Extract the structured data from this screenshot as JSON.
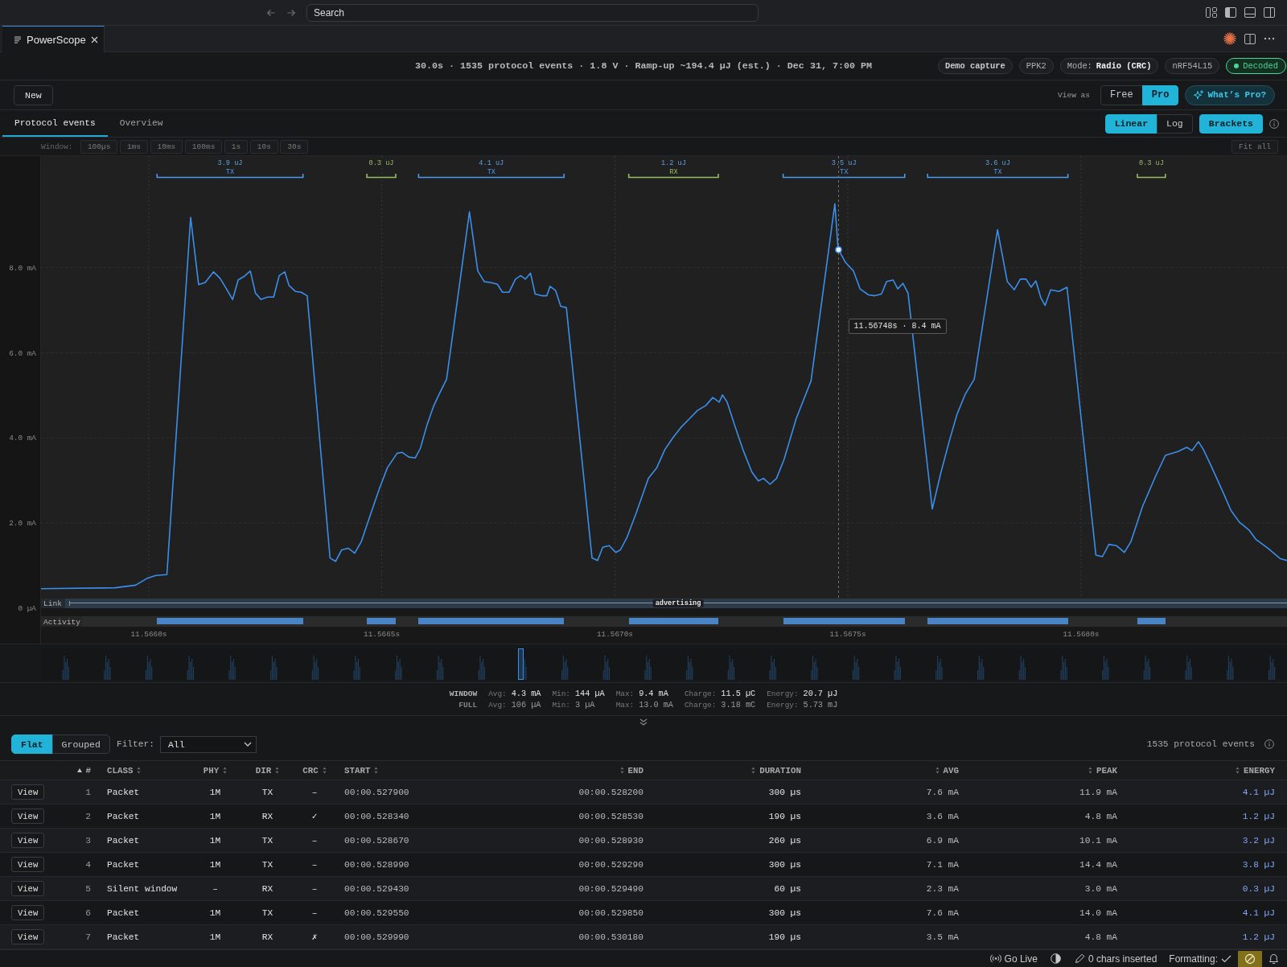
{
  "title_bar": {
    "search": {
      "placeholder": "Search"
    }
  },
  "editor_tabs": [
    {
      "label": "PowerScope",
      "selected": true
    }
  ],
  "header": {
    "summary": "30.0s · 1535 protocol events · 1.8 V · Ramp-up ~194.4 µJ (est.) · Dec 31, 7:00 PM",
    "badges": [
      {
        "kind": "strong",
        "text": "Demo capture"
      },
      {
        "kind": "plain",
        "text": "PPK2"
      },
      {
        "kind": "plain",
        "text": "Mode: **Radio (CRC)**"
      },
      {
        "kind": "plain",
        "text": "nRF54L15"
      },
      {
        "kind": "status",
        "text": "Decoded",
        "color": "#4cd49a"
      }
    ]
  },
  "toolbar": {
    "new_button": "New",
    "view_as_label": "View as",
    "view_as": [
      {
        "label": "Free",
        "selected": false
      },
      {
        "label": "Pro",
        "selected": true
      }
    ],
    "whats_pro_button": "What’s Pro?"
  },
  "view_tabs": [
    {
      "label": "Protocol events",
      "selected": true
    },
    {
      "label": "Overview",
      "selected": false
    }
  ],
  "scale": [
    {
      "label": "Linear",
      "selected": true
    },
    {
      "label": "Log",
      "selected": false
    }
  ],
  "brackets_toggle": {
    "label": "Brackets",
    "on": true
  },
  "window_bar": {
    "label": "Window:",
    "options": [
      {
        "label": "100µs",
        "selected": false
      },
      {
        "label": "1ms",
        "selected": false
      },
      {
        "label": "10ms",
        "selected": false
      },
      {
        "label": "100ms",
        "selected": false
      },
      {
        "label": "1s",
        "selected": false
      },
      {
        "label": "10s",
        "selected": false
      },
      {
        "label": "30s",
        "selected": false
      }
    ],
    "fit_all_button": "Fit all"
  },
  "chart": {
    "brackets": [
      {
        "energy": "3.9 uJ",
        "label": "TX",
        "color": "#4a9aee"
      },
      {
        "energy": "0.3 uJ",
        "color": "#97bd62"
      },
      {
        "energy": "4.1 uJ",
        "label": "TX",
        "color": "#4a9aee"
      },
      {
        "energy": "1.2 uJ",
        "label": "RX",
        "color": "#97bd62"
      },
      {
        "energy": "3.5 uJ",
        "label": "TX",
        "color": "#4a9aee"
      },
      {
        "energy": "3.6 uJ",
        "label": "TX",
        "color": "#4a9aee"
      },
      {
        "energy": "0.3 uJ",
        "color": "#97bd62"
      }
    ],
    "link": {
      "label": "Link",
      "state": "advertising"
    },
    "activity_label": "Activity",
    "chart_data": [
      {
        "type": "line",
        "xlim": [
          11.565769,
          11.568442
        ],
        "ylim": [
          0,
          10.62
        ],
        "xticks": [
          {
            "value": 11.566,
            "label": "11.5660s"
          },
          {
            "value": 11.5665,
            "label": "11.5665s"
          },
          {
            "value": 11.567,
            "label": "11.5670s"
          },
          {
            "value": 11.5675,
            "label": "11.5675s"
          },
          {
            "value": 11.568,
            "label": "11.5680s"
          }
        ],
        "yticks": [
          {
            "value": 0,
            "label": "0 µA"
          },
          {
            "value": 2,
            "label": "2.0 mA"
          },
          {
            "value": 4,
            "label": "4.0 mA"
          },
          {
            "value": 6,
            "label": "6.0 mA"
          },
          {
            "value": 8,
            "label": "8.0 mA"
          }
        ],
        "grid": true,
        "color": "#3b8fea",
        "x": [
          11.565769,
          11.565928,
          11.565972,
          11.565998,
          11.566016,
          11.566039,
          11.56609,
          11.566107,
          11.566121,
          11.566139,
          11.566153,
          11.566167,
          11.56618,
          11.566192,
          11.566204,
          11.566218,
          11.566229,
          11.566241,
          11.566255,
          11.566268,
          11.56628,
          11.566292,
          11.566301,
          11.566315,
          11.566327,
          11.56634,
          11.566389,
          11.566401,
          11.566414,
          11.566428,
          11.566442,
          11.566456,
          11.566474,
          11.566495,
          11.566512,
          11.566533,
          11.566544,
          11.566558,
          11.566572,
          11.566583,
          11.566597,
          11.566611,
          11.566625,
          11.566639,
          11.566688,
          11.566706,
          11.56672,
          11.566734,
          11.566748,
          11.566759,
          11.566773,
          11.566787,
          11.566798,
          11.566808,
          11.566819,
          11.566829,
          11.566843,
          11.566854,
          11.566861,
          11.566873,
          11.566884,
          11.566896,
          11.566951,
          11.566963,
          11.566974,
          11.566988,
          11.567002,
          11.567012,
          11.567026,
          11.567046,
          11.567072,
          11.56709,
          11.567107,
          11.567125,
          11.567143,
          11.56716,
          11.567178,
          11.567195,
          11.56721,
          11.567224,
          11.567231,
          11.567241,
          11.567257,
          11.567275,
          11.567294,
          11.567308,
          11.567319,
          11.567333,
          11.567347,
          11.567363,
          11.567389,
          11.567421,
          11.567472,
          11.567479,
          11.567495,
          11.567512,
          11.567526,
          11.567544,
          11.567558,
          11.567572,
          11.567583,
          11.567597,
          11.567607,
          11.567618,
          11.567629,
          11.567681,
          11.567699,
          11.567717,
          11.567734,
          11.567752,
          11.567771,
          11.567821,
          11.567842,
          11.567857,
          11.56787,
          11.567882,
          11.567893,
          11.567903,
          11.567914,
          11.567923,
          11.567935,
          11.567953,
          11.56797,
          11.568032,
          11.568046,
          11.56806,
          11.568076,
          11.568093,
          11.568107,
          11.568132,
          11.56816,
          11.568181,
          11.568208,
          11.568227,
          11.568238,
          11.568252,
          11.568262,
          11.568278,
          11.568305,
          11.568322,
          11.56834,
          11.568361,
          11.568375,
          11.568401,
          11.568428,
          11.568442
        ],
        "values": [
          0.46,
          0.48,
          0.54,
          0.71,
          0.77,
          0.79,
          9.18,
          7.6,
          7.65,
          7.9,
          7.75,
          7.5,
          7.25,
          7.71,
          7.79,
          7.92,
          7.4,
          7.25,
          7.31,
          7.31,
          7.81,
          7.9,
          7.58,
          7.44,
          7.42,
          7.34,
          1.18,
          1.1,
          1.37,
          1.41,
          1.29,
          1.56,
          2.14,
          2.81,
          3.3,
          3.64,
          3.66,
          3.55,
          3.53,
          3.76,
          4.3,
          4.74,
          5.07,
          5.38,
          9.31,
          7.92,
          7.67,
          7.65,
          7.61,
          7.42,
          7.42,
          7.73,
          7.81,
          7.73,
          7.87,
          7.38,
          7.34,
          7.34,
          7.56,
          7.46,
          7.09,
          7.06,
          1.18,
          1.12,
          1.43,
          1.47,
          1.31,
          1.37,
          1.66,
          2.24,
          3.05,
          3.3,
          3.72,
          4.01,
          4.26,
          4.45,
          4.65,
          4.76,
          4.95,
          4.84,
          5.01,
          4.84,
          4.3,
          3.72,
          3.2,
          2.99,
          3.05,
          2.91,
          3.05,
          3.49,
          4.45,
          5.34,
          9.5,
          8.44,
          8.12,
          7.92,
          7.5,
          7.36,
          7.34,
          7.38,
          7.67,
          7.71,
          7.5,
          7.63,
          7.4,
          2.33,
          3.16,
          3.91,
          4.55,
          5.03,
          5.38,
          8.89,
          7.67,
          7.48,
          7.73,
          7.73,
          7.54,
          7.69,
          7.29,
          7.11,
          7.48,
          7.44,
          7.54,
          1.25,
          1.21,
          1.5,
          1.47,
          1.31,
          1.56,
          2.39,
          3.1,
          3.59,
          3.68,
          3.78,
          3.7,
          3.91,
          3.74,
          3.37,
          2.72,
          2.29,
          2.02,
          1.83,
          1.62,
          1.41,
          1.16,
          1.12
        ],
        "ref_lines": [
          {
            "axis": "x",
            "value": 11.56748,
            "label": "11.56748s · 8.4 mA",
            "color": "#707070",
            "line_style": "dashed"
          }
        ]
      }
    ]
  },
  "stats": [
    {
      "label": "WINDOW",
      "highlighted": true,
      "items": [
        {
          "name": "Avg:",
          "value": "4.3 mA"
        },
        {
          "name": "Min:",
          "value": "144 µA"
        },
        {
          "name": "Max:",
          "value": "9.4 mA"
        },
        {
          "name": "Charge:",
          "value": "11.5 µC"
        },
        {
          "name": "Energy:",
          "value": "20.7 µJ"
        }
      ]
    },
    {
      "label": "FULL",
      "highlighted": false,
      "items": [
        {
          "name": "Avg:",
          "value": "106 µA"
        },
        {
          "name": "Min:",
          "value": "3 µA"
        },
        {
          "name": "Max:",
          "value": "13.0 mA"
        },
        {
          "name": "Charge:",
          "value": "3.18 mC"
        },
        {
          "name": "Energy:",
          "value": "5.73 mJ"
        }
      ]
    }
  ],
  "events": {
    "modes": [
      {
        "label": "Flat",
        "selected": true
      },
      {
        "label": "Grouped",
        "selected": false
      }
    ],
    "filter": {
      "label": "Filter:",
      "value": "All"
    },
    "count": "1535 protocol events",
    "columns": [
      {
        "label": "#",
        "sorted": true
      },
      {
        "label": "CLASS",
        "sorted": false
      },
      {
        "label": "PHY",
        "sorted": false
      },
      {
        "label": "DIR",
        "sorted": false
      },
      {
        "label": "CRC",
        "sorted": false
      },
      {
        "label": "START",
        "sorted": false
      },
      {
        "label": "END",
        "sorted": false
      },
      {
        "label": "DURATION",
        "sorted": false
      },
      {
        "label": "AVG",
        "sorted": false
      },
      {
        "label": "PEAK",
        "sorted": false
      },
      {
        "label": "ENERGY",
        "sorted": false
      }
    ],
    "rows": [
      {
        "action": "View",
        "cells": [
          "1",
          "Packet",
          "1M",
          "TX",
          "–",
          "00:00.527900",
          "00:00.528200",
          "300 µs",
          "7.6 mA",
          "11.9 mA",
          "4.1 µJ"
        ]
      },
      {
        "action": "View",
        "cells": [
          "2",
          "Packet",
          "1M",
          "RX",
          "✓",
          "00:00.528340",
          "00:00.528530",
          "190 µs",
          "3.6 mA",
          "4.8 mA",
          "1.2 µJ"
        ]
      },
      {
        "action": "View",
        "cells": [
          "3",
          "Packet",
          "1M",
          "TX",
          "–",
          "00:00.528670",
          "00:00.528930",
          "260 µs",
          "6.9 mA",
          "10.1 mA",
          "3.2 µJ"
        ]
      },
      {
        "action": "View",
        "cells": [
          "4",
          "Packet",
          "1M",
          "TX",
          "–",
          "00:00.528990",
          "00:00.529290",
          "300 µs",
          "7.1 mA",
          "14.4 mA",
          "3.8 µJ"
        ]
      },
      {
        "action": "View",
        "cells": [
          "5",
          "Silent window",
          "–",
          "RX",
          "–",
          "00:00.529430",
          "00:00.529490",
          "60 µs",
          "2.3 mA",
          "3.0 mA",
          "0.3 µJ"
        ]
      },
      {
        "action": "View",
        "cells": [
          "6",
          "Packet",
          "1M",
          "TX",
          "–",
          "00:00.529550",
          "00:00.529850",
          "300 µs",
          "7.6 mA",
          "14.0 mA",
          "4.1 µJ"
        ]
      },
      {
        "action": "View",
        "cells": [
          "7",
          "Packet",
          "1M",
          "RX",
          "✗",
          "00:00.529990",
          "00:00.530180",
          "190 µs",
          "3.5 mA",
          "4.8 mA",
          "1.2 µJ"
        ]
      }
    ]
  },
  "status_bar": {
    "go_live": "Go Live",
    "chars_inserted": "0 chars inserted",
    "formatting": "Formatting:"
  }
}
